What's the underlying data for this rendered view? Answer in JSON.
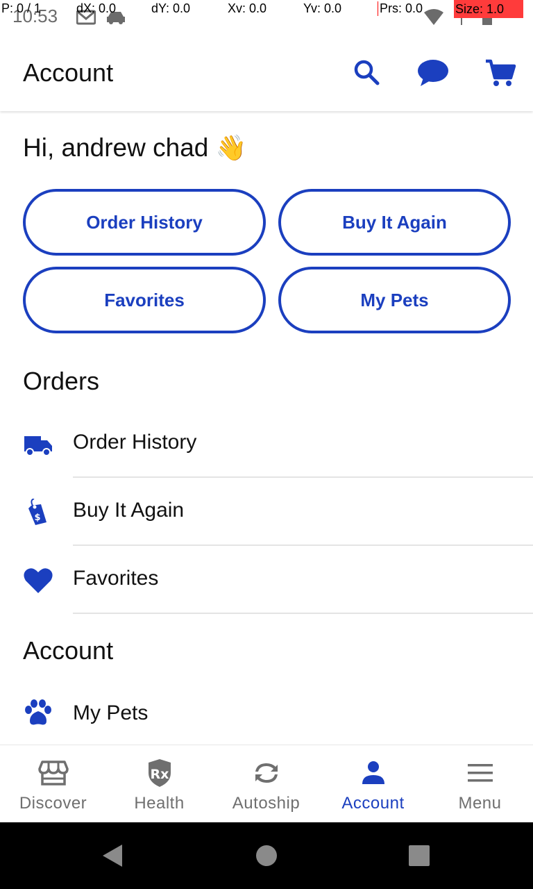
{
  "status_bar": {
    "time": "10:53",
    "icons": [
      "gmail-icon",
      "car-icon",
      "wifi-icon",
      "signal-icon",
      "battery-icon"
    ]
  },
  "debug_overlay": {
    "p": "P: 0 / 1",
    "dx": "dX: 0.0",
    "dy": "dY: 0.0",
    "xv": "Xv: 0.0",
    "yv": "Yv: 0.0",
    "prs": "Prs: 0.0",
    "size": "Size: 1.0"
  },
  "app_bar": {
    "title": "Account",
    "actions": [
      "search-icon",
      "chat-icon",
      "cart-icon"
    ]
  },
  "greeting": {
    "text": "Hi, andrew chad",
    "emoji": "👋"
  },
  "quick_actions": [
    {
      "label": "Order History"
    },
    {
      "label": "Buy It Again"
    },
    {
      "label": "Favorites"
    },
    {
      "label": "My Pets"
    }
  ],
  "orders_section": {
    "title": "Orders",
    "items": [
      {
        "label": "Order History",
        "icon": "truck-icon"
      },
      {
        "label": "Buy It Again",
        "icon": "price-tag-icon"
      },
      {
        "label": "Favorites",
        "icon": "heart-icon"
      }
    ]
  },
  "account_section": {
    "title": "Account",
    "items": [
      {
        "label": "My Pets",
        "icon": "paw-icon"
      }
    ]
  },
  "bottom_nav": [
    {
      "label": "Discover",
      "icon": "store-icon",
      "active": false
    },
    {
      "label": "Health",
      "icon": "rx-icon",
      "active": false
    },
    {
      "label": "Autoship",
      "icon": "autoship-icon",
      "active": false
    },
    {
      "label": "Account",
      "icon": "person-icon",
      "active": true
    },
    {
      "label": "Menu",
      "icon": "hamburger-icon",
      "active": false
    }
  ],
  "colors": {
    "accent": "#1b3fbf",
    "inactive": "#6f6f6f",
    "text": "#111111"
  }
}
